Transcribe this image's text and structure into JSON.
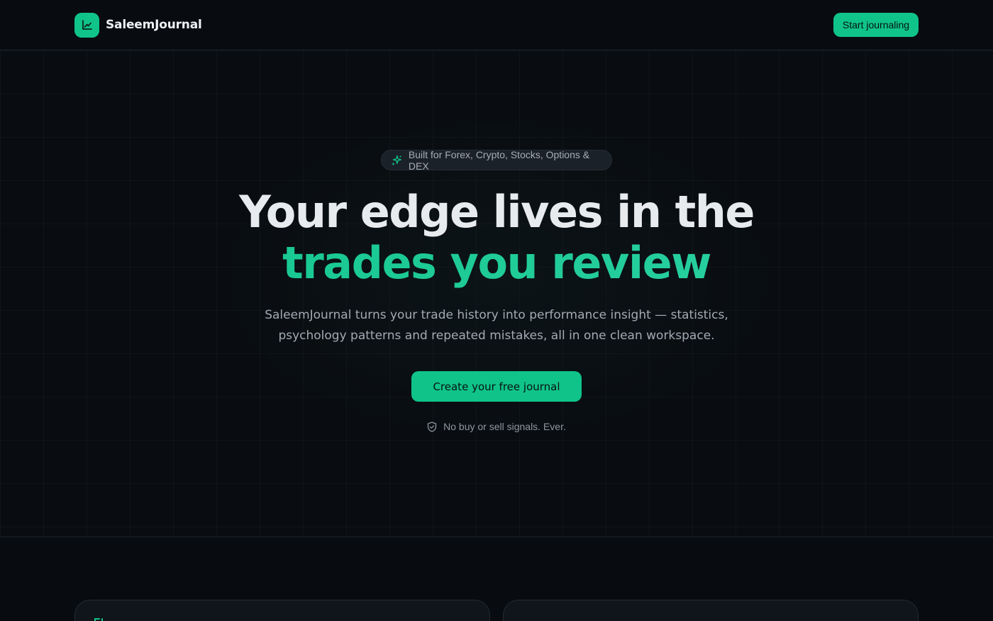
{
  "header": {
    "brand_name": "SaleemJournal",
    "logo_icon": "chart-line-icon",
    "cta_label": "Start journaling"
  },
  "hero": {
    "pill_icon": "sparkles-icon",
    "pill_text": "Built for Forex, Crypto, Stocks, Options & DEX",
    "headline_line1": "Your edge lives in the",
    "headline_line2": "trades you review",
    "subtext": "SaleemJournal turns your trade history into performance insight — statistics, psychology patterns and repeated mistakes, all in one clean workspace.",
    "cta_label": "Create your free journal",
    "disclaimer_icon": "shield-check-icon",
    "disclaimer_text": "No buy or sell signals. Ever."
  },
  "colors": {
    "background": "#080c10",
    "accent": "#10c489",
    "text_primary": "#e8ebee",
    "text_muted": "#a3aab2",
    "border": "#1c232b"
  }
}
